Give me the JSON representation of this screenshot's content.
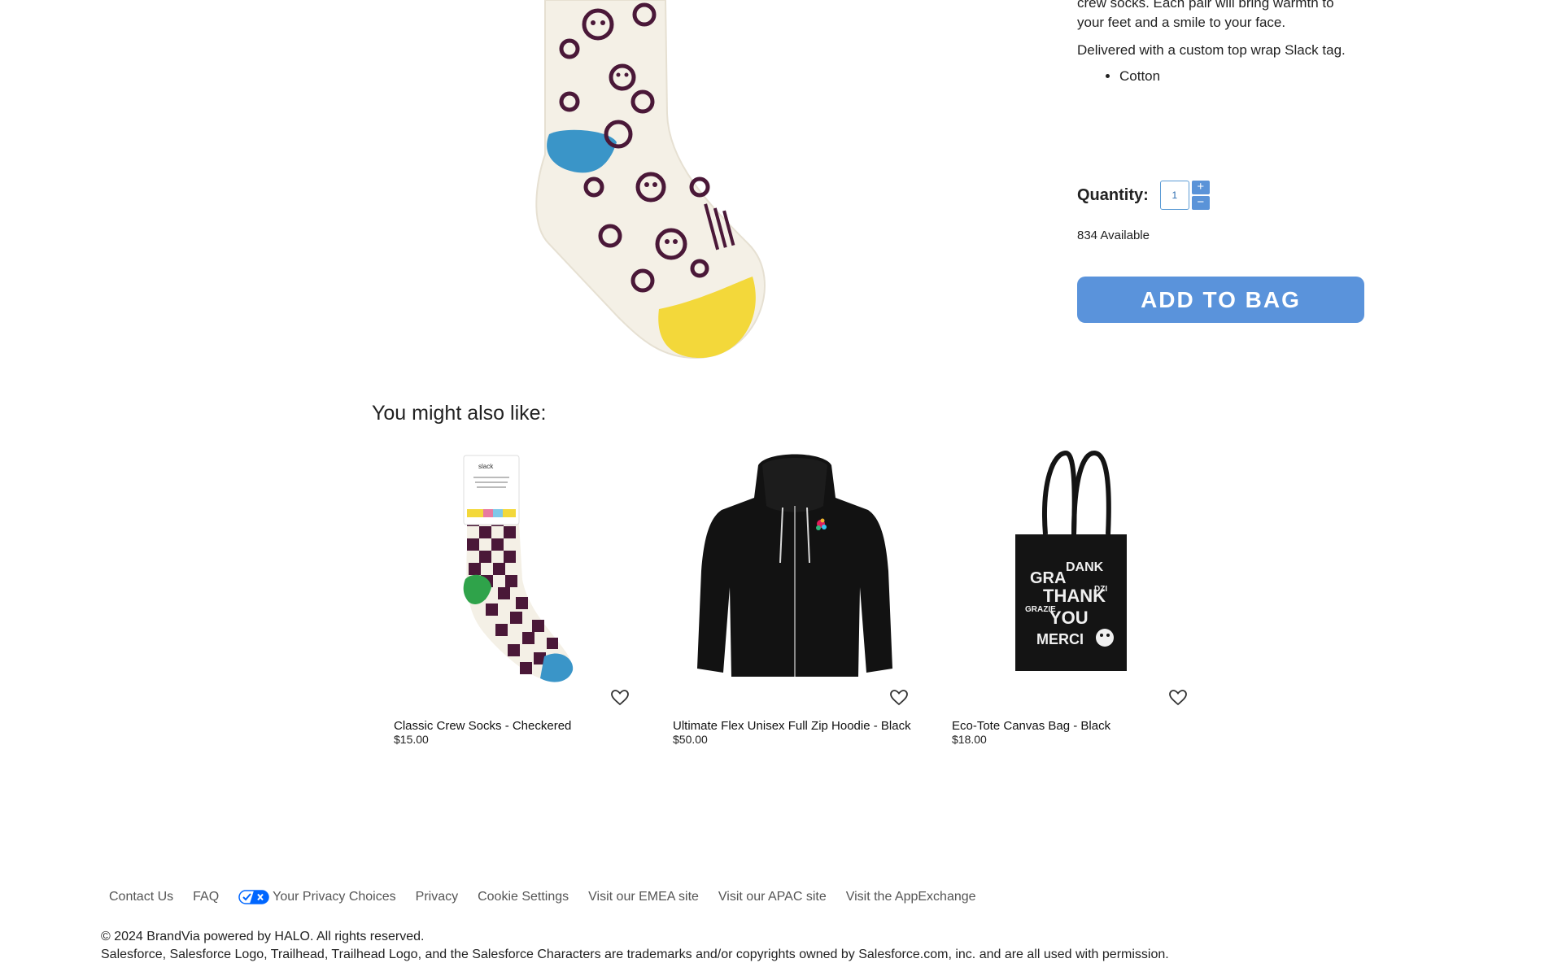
{
  "product": {
    "description_partial": "crew socks. Each pair will bring warmth to",
    "description_continued": "your feet and a smile to your face.",
    "tag_note": "Delivered with a custom top wrap Slack tag.",
    "features": [
      "Cotton"
    ],
    "quantity_label": "Quantity:",
    "quantity_value": "1",
    "increment_symbol": "+",
    "decrement_symbol": "−",
    "available_text": "834 Available",
    "add_to_bag_label": "ADD TO BAG"
  },
  "recommendations": {
    "heading": "You might also like:",
    "items": [
      {
        "name": "Classic Crew Socks - Checkered",
        "price": "$15.00",
        "icon": "heart-icon"
      },
      {
        "name": "Ultimate Flex Unisex Full Zip Hoodie - Black",
        "price": "$50.00",
        "icon": "heart-icon"
      },
      {
        "name": "Eco-Tote Canvas Bag - Black",
        "price": "$18.00",
        "icon": "heart-icon"
      }
    ]
  },
  "footer": {
    "links": [
      "Contact Us",
      "FAQ",
      "Your Privacy Choices",
      "Privacy",
      "Cookie Settings",
      "Visit our EMEA site",
      "Visit our APAC site",
      "Visit the AppExchange"
    ],
    "copyright": "© 2024 BrandVia powered by HALO. All rights reserved.",
    "trademark": "Salesforce, Salesforce Logo, Trailhead, Trailhead Logo, and the Salesforce Characters are trademarks and/or copyrights owned by Salesforce.com, inc. and are all used with permission."
  },
  "colors": {
    "accent": "#5a93db",
    "sock_purple": "#4a1838",
    "sock_cream": "#f4f0e6",
    "sock_blue": "#3a95c8",
    "sock_yellow": "#f3d83a"
  }
}
